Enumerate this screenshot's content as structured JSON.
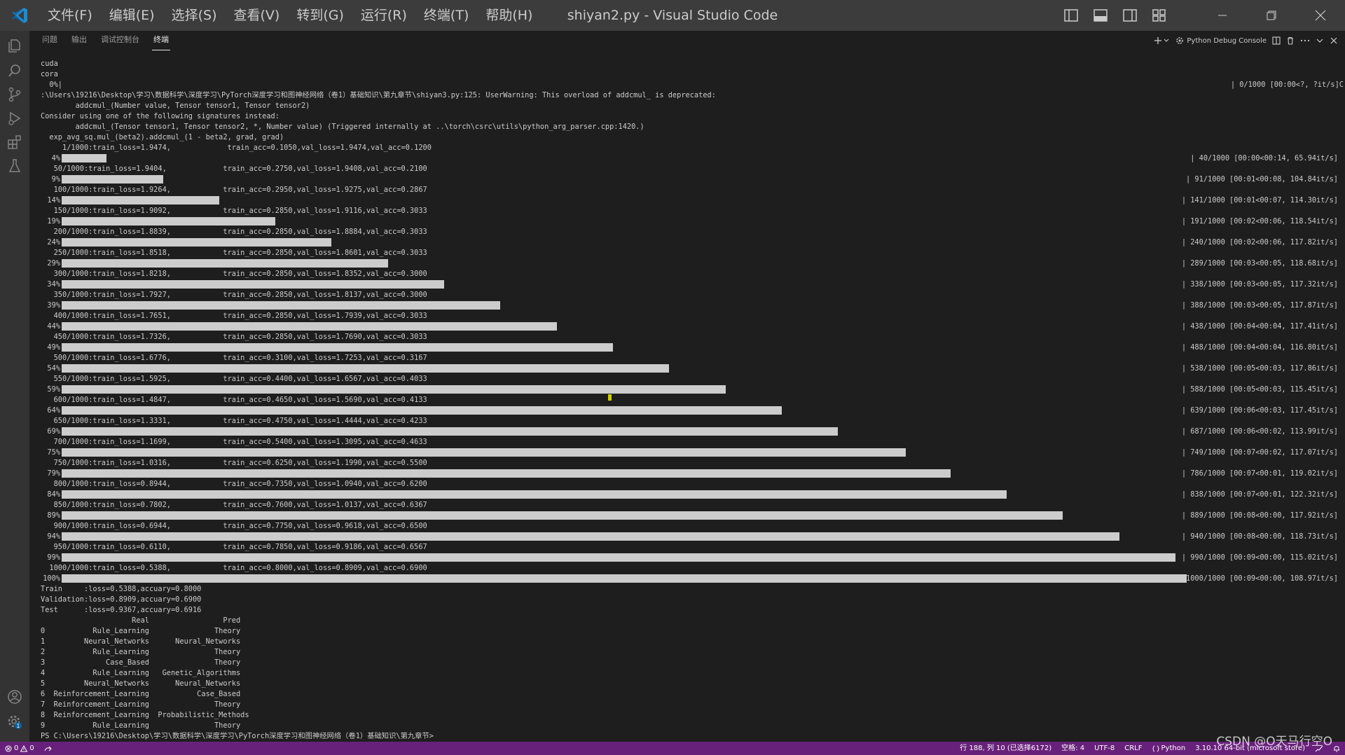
{
  "titlebar": {
    "window_title": "shiyan2.py - Visual Studio Code",
    "menu": [
      "文件(F)",
      "编辑(E)",
      "选择(S)",
      "查看(V)",
      "转到(G)",
      "运行(R)",
      "终端(T)",
      "帮助(H)"
    ]
  },
  "panel": {
    "tabs": [
      "问题",
      "输出",
      "调试控制台",
      "终端"
    ],
    "active_tab": "终端",
    "terminal_name": "Python Debug Console"
  },
  "terminal": {
    "pre_lines": [
      "cuda",
      "cora"
    ],
    "zero_line": "  0%|",
    "zero_stats": "| 0/1000 [00:00<?, ?it/s]C",
    "warning_lines": [
      ":\\Users\\19216\\Desktop\\学习\\数据科学\\深度学习\\PyTorch深度学习和图神经网络（卷1）基础知识\\第九章节\\shiyan3.py:125: UserWarning: This overload of addcmul_ is deprecated:",
      "        addcmul_(Number value, Tensor tensor1, Tensor tensor2)",
      "Consider using one of the following signatures instead:",
      "        addcmul_(Tensor tensor1, Tensor tensor2, *, Number value) (Triggered internally at ..\\torch\\csrc\\utils\\python_arg_parser.cpp:1420.)",
      "  exp_avg_sq.mul_(beta2).addcmul_(1 - beta2, grad, grad)"
    ],
    "epochs": [
      {
        "log": "     1/1000:train_loss=1.9474,             train_acc=0.1050,val_loss=1.9474,val_acc=0.1200",
        "pct": "4%",
        "progress": 0.04,
        "stats": "| 40/1000 [00:00<00:14, 65.94it/s]"
      },
      {
        "log": "   50/1000:train_loss=1.9404,             train_acc=0.2750,val_loss=1.9408,val_acc=0.2100",
        "pct": "9%",
        "progress": 0.09,
        "stats": "| 91/1000 [00:01<00:08, 104.84it/s]"
      },
      {
        "log": "   100/1000:train_loss=1.9264,            train_acc=0.2950,val_loss=1.9275,val_acc=0.2867",
        "pct": "14%",
        "progress": 0.14,
        "stats": "| 141/1000 [00:01<00:07, 114.30it/s]"
      },
      {
        "log": "   150/1000:train_loss=1.9092,            train_acc=0.2850,val_loss=1.9116,val_acc=0.3033",
        "pct": "19%",
        "progress": 0.19,
        "stats": "| 191/1000 [00:02<00:06, 118.54it/s]"
      },
      {
        "log": "   200/1000:train_loss=1.8839,            train_acc=0.2850,val_loss=1.8884,val_acc=0.3033",
        "pct": "24%",
        "progress": 0.24,
        "stats": "| 240/1000 [00:02<00:06, 117.82it/s]"
      },
      {
        "log": "   250/1000:train_loss=1.8518,            train_acc=0.2850,val_loss=1.8601,val_acc=0.3033",
        "pct": "29%",
        "progress": 0.29,
        "stats": "| 289/1000 [00:03<00:05, 118.68it/s]"
      },
      {
        "log": "   300/1000:train_loss=1.8218,            train_acc=0.2850,val_loss=1.8352,val_acc=0.3000",
        "pct": "34%",
        "progress": 0.34,
        "stats": "| 338/1000 [00:03<00:05, 117.32it/s]"
      },
      {
        "log": "   350/1000:train_loss=1.7927,            train_acc=0.2850,val_loss=1.8137,val_acc=0.3000",
        "pct": "39%",
        "progress": 0.39,
        "stats": "| 388/1000 [00:03<00:05, 117.87it/s]"
      },
      {
        "log": "   400/1000:train_loss=1.7651,            train_acc=0.2850,val_loss=1.7939,val_acc=0.3033",
        "pct": "44%",
        "progress": 0.44,
        "stats": "| 438/1000 [00:04<00:04, 117.41it/s]"
      },
      {
        "log": "   450/1000:train_loss=1.7326,            train_acc=0.2850,val_loss=1.7690,val_acc=0.3033",
        "pct": "49%",
        "progress": 0.49,
        "stats": "| 488/1000 [00:04<00:04, 116.80it/s]"
      },
      {
        "log": "   500/1000:train_loss=1.6776,            train_acc=0.3100,val_loss=1.7253,val_acc=0.3167",
        "pct": "54%",
        "progress": 0.54,
        "stats": "| 538/1000 [00:05<00:03, 117.86it/s]"
      },
      {
        "log": "   550/1000:train_loss=1.5925,            train_acc=0.4400,val_loss=1.6567,val_acc=0.4033",
        "pct": "59%",
        "progress": 0.59,
        "stats": "| 588/1000 [00:05<00:03, 115.45it/s]"
      },
      {
        "log": "   600/1000:train_loss=1.4847,            train_acc=0.4650,val_loss=1.5690,val_acc=0.4133",
        "pct": "64%",
        "progress": 0.64,
        "stats": "| 639/1000 [00:06<00:03, 117.45it/s]"
      },
      {
        "log": "   650/1000:train_loss=1.3331,            train_acc=0.4750,val_loss=1.4444,val_acc=0.4233",
        "pct": "69%",
        "progress": 0.69,
        "stats": "| 687/1000 [00:06<00:02, 113.99it/s]"
      },
      {
        "log": "   700/1000:train_loss=1.1699,            train_acc=0.5400,val_loss=1.3095,val_acc=0.4633",
        "pct": "75%",
        "progress": 0.75,
        "stats": "| 749/1000 [00:07<00:02, 117.07it/s]"
      },
      {
        "log": "   750/1000:train_loss=1.0316,            train_acc=0.6250,val_loss=1.1990,val_acc=0.5500",
        "pct": "79%",
        "progress": 0.79,
        "stats": "| 786/1000 [00:07<00:01, 119.02it/s]"
      },
      {
        "log": "   800/1000:train_loss=0.8944,            train_acc=0.7350,val_loss=1.0940,val_acc=0.6200",
        "pct": "84%",
        "progress": 0.84,
        "stats": "| 838/1000 [00:07<00:01, 122.32it/s]"
      },
      {
        "log": "   850/1000:train_loss=0.7802,            train_acc=0.7600,val_loss=1.0137,val_acc=0.6367",
        "pct": "89%",
        "progress": 0.89,
        "stats": "| 889/1000 [00:08<00:00, 117.92it/s]"
      },
      {
        "log": "   900/1000:train_loss=0.6944,            train_acc=0.7750,val_loss=0.9618,val_acc=0.6500",
        "pct": "94%",
        "progress": 0.94,
        "stats": "| 940/1000 [00:08<00:00, 118.73it/s]"
      },
      {
        "log": "   950/1000:train_loss=0.6110,            train_acc=0.7850,val_loss=0.9186,val_acc=0.6567",
        "pct": "99%",
        "progress": 0.99,
        "stats": "| 990/1000 [00:09<00:00, 115.02it/s]"
      },
      {
        "log": "  1000/1000:train_loss=0.5388,            train_acc=0.8000,val_loss=0.8909,val_acc=0.6900",
        "pct": "100%",
        "progress": 1.0,
        "stats": "| 1000/1000 [00:09<00:00, 108.97it/s]"
      }
    ],
    "summary_lines": [
      "Train     :loss=0.5388,accuary=0.8000",
      "Validation:loss=0.8909,accuary=0.6900",
      "Test      :loss=0.9367,accuary=0.6916"
    ],
    "table_header": "                     Real                 Pred",
    "table_rows": [
      "0           Rule_Learning               Theory",
      "1         Neural_Networks      Neural_Networks",
      "2           Rule_Learning               Theory",
      "3              Case_Based               Theory",
      "4           Rule_Learning   Genetic_Algorithms",
      "5         Neural_Networks      Neural_Networks",
      "6  Reinforcement_Learning           Case_Based",
      "7  Reinforcement_Learning               Theory",
      "8  Reinforcement_Learning  Probabilistic_Methods",
      "9           Rule_Learning               Theory"
    ],
    "prompt": "PS C:\\Users\\19216\\Desktop\\学习\\数据科学\\深度学习\\PyTorch深度学习和图神经网络（卷1）基础知识\\第九章节>"
  },
  "statusbar": {
    "errors": "0",
    "warnings": "0",
    "cursor_position": "行 188, 列 10 (已选择6172)",
    "indent": "空格: 4",
    "encoding": "UTF-8",
    "eol": "CRLF",
    "language": "Python",
    "interpreter": "3.10.10 64-bit (microsoft store)",
    "accent": "#68217a"
  },
  "watermark": "CSDN @O天马行空O",
  "icons": {
    "activity": [
      "explorer-icon",
      "search-icon",
      "source-control-icon",
      "run-debug-icon",
      "extensions-icon",
      "testing-icon",
      "account-icon",
      "settings-gear-icon"
    ]
  }
}
